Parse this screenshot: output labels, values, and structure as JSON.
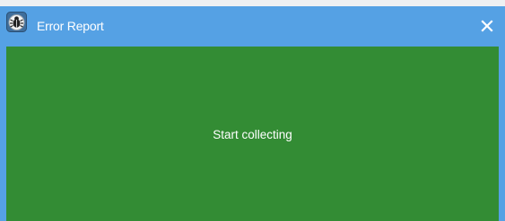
{
  "window": {
    "title": "Error Report",
    "app_icon": "bug-icon",
    "close_icon": "close-icon"
  },
  "content": {
    "status": "Start collecting"
  },
  "colors": {
    "titlebar": "#55a1e4",
    "content_bg": "#338c34",
    "text": "#ffffff"
  }
}
